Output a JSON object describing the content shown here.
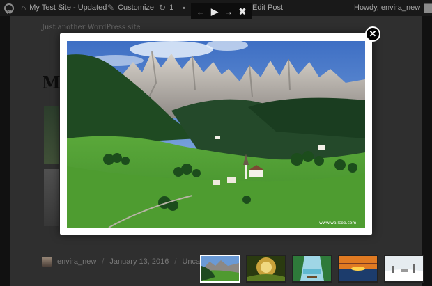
{
  "admin_bar": {
    "site_name": "My Test Site - Updated",
    "customize": "Customize",
    "updates_count": "1",
    "edit_post": "Edit Post",
    "greeting": "Howdy, envira_new"
  },
  "page": {
    "tagline": "Just another WordPress site",
    "title_fragment": "My",
    "meta": {
      "author": "envira_new",
      "date": "January 13, 2016",
      "category_fragment": "Uncateg"
    }
  },
  "toolbar": {
    "prev_icon": "←",
    "play_icon": "▶",
    "next_icon": "→",
    "close_icon": "✖"
  },
  "lightbox": {
    "close_icon": "✕",
    "watermark": "www.wallcoo.com"
  },
  "thumbnails": [
    {
      "name": "mountain-valley",
      "active": true
    },
    {
      "name": "forest-path",
      "active": false
    },
    {
      "name": "lake-bench",
      "active": false
    },
    {
      "name": "sunset-sea",
      "active": false
    },
    {
      "name": "winter-scene",
      "active": false
    }
  ]
}
